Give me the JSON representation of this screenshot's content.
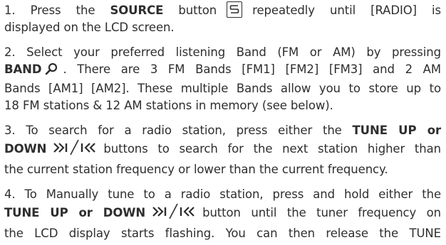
{
  "steps": [
    {
      "l1_a": "1. Press the ",
      "l1_b": "SOURCE",
      "l1_c": " button",
      "l1_d": "repeatedly until [RADIO] is",
      "l2": "displayed on the LCD screen.",
      "icon": "source-icon"
    },
    {
      "l1": "2. Select your preferred listening Band (FM or AM) by pressing",
      "l2_a": "BAND",
      "l2_b": ". There are 3 FM Bands [FM1] [FM2] [FM3] and 2 AM",
      "l3": "Bands [AM1] [AM2]. These multiple Bands allow you to store up to",
      "l4": "18 FM stations & 12 AM stations in memory (see below).",
      "icon": "search-icon"
    },
    {
      "l1_a": "3. To search for a radio station, press either the ",
      "l1_b": "TUNE UP or",
      "l2_a": "DOWN",
      "l2_b": "buttons to search for the next station higher than",
      "l3": "the current station frequency or lower than the current frequency.",
      "icon": "tune-up-down-icon"
    },
    {
      "l1": "4. To Manually tune to a radio station, press and hold either the",
      "l2_a": "TUNE UP or DOWN",
      "l2_b": "button until the tuner frequency on",
      "l3": "the LCD display starts flashing. You can then release the TUNE",
      "icon": "tune-up-down-icon"
    }
  ]
}
